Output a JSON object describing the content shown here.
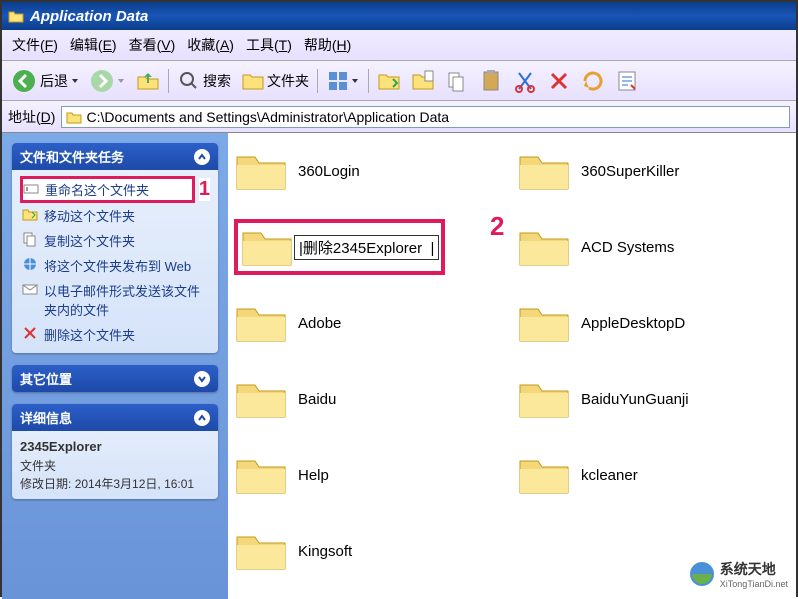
{
  "window": {
    "title": "Application Data"
  },
  "menu": {
    "file": "文件",
    "file_u": "F",
    "edit": "编辑",
    "edit_u": "E",
    "view": "查看",
    "view_u": "V",
    "fav": "收藏",
    "fav_u": "A",
    "tools": "工具",
    "tools_u": "T",
    "help": "帮助",
    "help_u": "H"
  },
  "toolbar": {
    "back": "后退",
    "search": "搜索",
    "folders": "文件夹"
  },
  "address": {
    "label": "地址",
    "label_u": "D",
    "path": "C:\\Documents and Settings\\Administrator\\Application Data"
  },
  "sidebar": {
    "tasks_header": "文件和文件夹任务",
    "tasks": {
      "rename": "重命名这个文件夹",
      "move": "移动这个文件夹",
      "copy": "复制这个文件夹",
      "publish": "将这个文件夹发布到 Web",
      "email": "以电子邮件形式发送该文件夹内的文件",
      "delete": "删除这个文件夹"
    },
    "other_header": "其它位置",
    "details_header": "详细信息",
    "details": {
      "name": "2345Explorer",
      "type": "文件夹",
      "modified_label": "修改日期:",
      "modified_value": "2014年3月12日, 16:01"
    }
  },
  "folders": {
    "r1c1": "360Login",
    "r1c2": "360SuperKiller",
    "r2c1": "删除2345Explorer",
    "r2c2": "ACD Systems",
    "r3c1": "Adobe",
    "r3c2": "AppleDesktopD",
    "r4c1": "Baidu",
    "r4c2": "BaiduYunGuanji",
    "r5c1": "Help",
    "r5c2": "kcleaner",
    "r6c1": "Kingsoft"
  },
  "callouts": {
    "one": "1",
    "two": "2"
  },
  "watermark": {
    "text": "系统天地",
    "url": "XiTongTianDi.net"
  }
}
